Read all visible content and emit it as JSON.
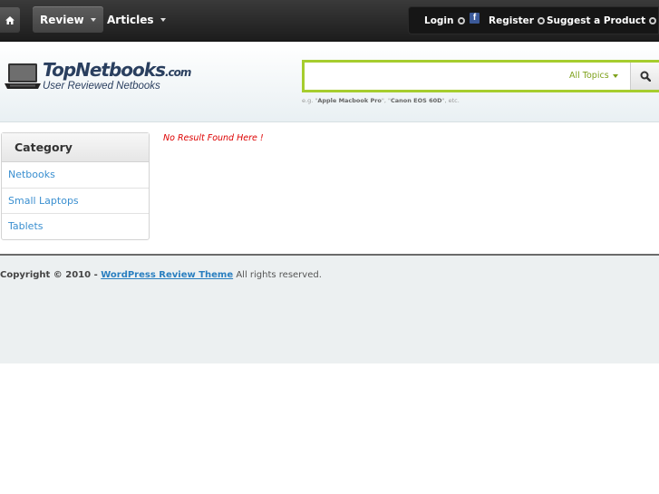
{
  "nav": {
    "home_icon": "home-icon",
    "items": [
      {
        "label": "Review",
        "active": true
      },
      {
        "label": "Articles",
        "active": false
      }
    ]
  },
  "userbar": {
    "login": "Login",
    "facebook_icon": "facebook-icon",
    "facebook_glyph": "f",
    "register": "Register",
    "suggest": "Suggest a Product"
  },
  "logo": {
    "title": "TopNetbooks",
    "domain": ".com",
    "tagline": "User Reviewed Netbooks"
  },
  "search": {
    "value": "",
    "placeholder": "",
    "topics_label": "All Topics",
    "hint_prefix": "e.g. \"",
    "hint_example1": "Apple Macbook Pro",
    "hint_mid": "\", \"",
    "hint_example2": "Canon EOS 60D",
    "hint_suffix": "\", etc.",
    "accent_color": "#a6cd2e"
  },
  "sidebar": {
    "heading": "Category",
    "items": [
      {
        "label": "Netbooks"
      },
      {
        "label": "Small Laptops"
      },
      {
        "label": "Tablets"
      }
    ]
  },
  "main": {
    "message": "No Result Found Here !"
  },
  "footer": {
    "prefix": "Copyright © 2010 - ",
    "link_text": "WordPress Review Theme",
    "suffix": " All rights reserved."
  }
}
